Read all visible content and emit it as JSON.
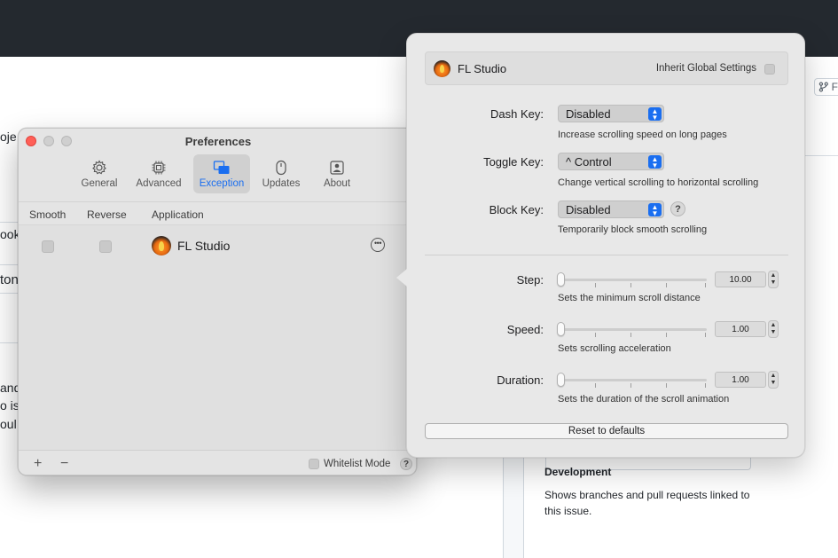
{
  "background": {
    "left_fragments": [
      "oje",
      "ook",
      "ton",
      "and",
      "o is",
      "oul"
    ],
    "branch_label": "F",
    "development_heading": "Development",
    "development_text_line1": "Shows branches and pull requests linked to",
    "development_text_line2": "this issue."
  },
  "prefs": {
    "title": "Preferences",
    "toolbar": [
      {
        "label": "General",
        "icon": "gear-icon"
      },
      {
        "label": "Advanced",
        "icon": "chip-icon"
      },
      {
        "label": "Exception",
        "icon": "exception-windows-icon",
        "active": true
      },
      {
        "label": "Updates",
        "icon": "updates-icon"
      },
      {
        "label": "About",
        "icon": "about-person-icon"
      }
    ],
    "columns": {
      "smooth": "Smooth",
      "reverse": "Reverse",
      "application": "Application"
    },
    "rows": [
      {
        "app": "FL Studio",
        "smooth": false,
        "reverse": false
      }
    ],
    "footer": {
      "add": "+",
      "remove": "−",
      "whitelist_label": "Whitelist Mode",
      "help": "?"
    }
  },
  "popover": {
    "app_name": "FL Studio",
    "inherit_label": "Inherit Global Settings",
    "dash_key": {
      "label": "Dash Key:",
      "value": "Disabled",
      "hint": "Increase scrolling speed on long pages"
    },
    "toggle_key": {
      "label": "Toggle Key:",
      "value": "^ Control",
      "hint": "Change vertical scrolling to horizontal scrolling"
    },
    "block_key": {
      "label": "Block Key:",
      "value": "Disabled",
      "hint": "Temporarily block smooth scrolling",
      "help": "?"
    },
    "step": {
      "label": "Step:",
      "value": "10.00",
      "hint": "Sets the minimum scroll distance"
    },
    "speed": {
      "label": "Speed:",
      "value": "1.00",
      "hint": "Sets scrolling acceleration"
    },
    "duration": {
      "label": "Duration:",
      "value": "1.00",
      "hint": "Sets the duration of the scroll animation"
    },
    "reset_label": "Reset to defaults"
  },
  "colors": {
    "accent": "#1a6ef0",
    "close": "#ff5f57",
    "topbar": "#24292f"
  }
}
